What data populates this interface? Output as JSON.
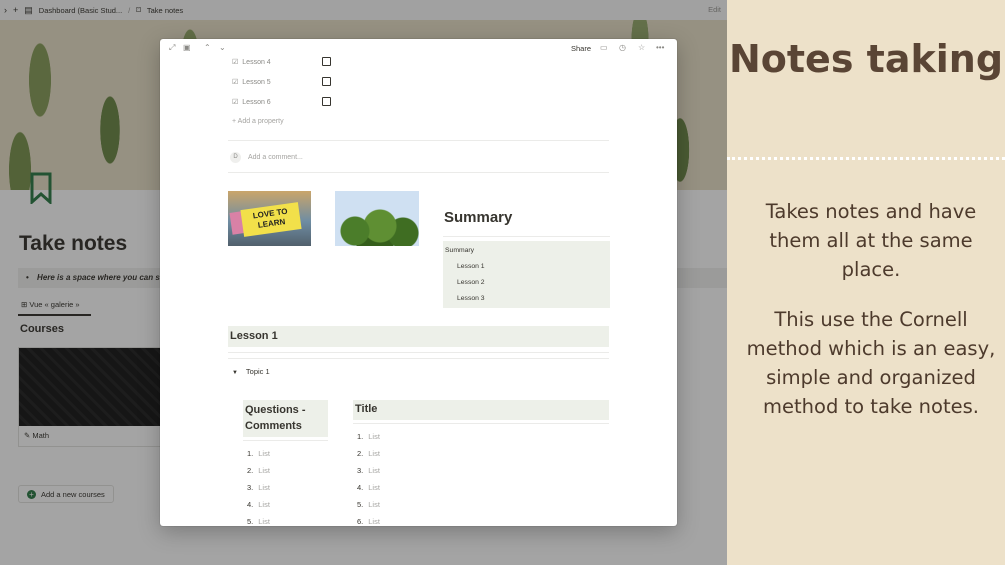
{
  "topbar": {
    "breadcrumb_1": "Dashboard (Basic Stud...",
    "separator": "/",
    "breadcrumb_2": "Take notes",
    "edit_label": "Edit"
  },
  "background_page": {
    "title": "Take notes",
    "callout": "Here is a space where you can s",
    "gallery_tab": "Vue « galerie »",
    "courses_heading": "Courses",
    "course_card_label": "Math",
    "add_course_label": "Add a new courses"
  },
  "modal": {
    "share_label": "Share",
    "properties": [
      {
        "label": "Lesson 4"
      },
      {
        "label": "Lesson 5"
      },
      {
        "label": "Lesson 6"
      }
    ],
    "add_property": "Add a property",
    "comment_avatar": "D",
    "comment_placeholder": "Add a comment...",
    "image_text": "LOVE TO LEARN",
    "summary_title": "Summary",
    "summary_box": {
      "heading": "Summary",
      "items": [
        "Lesson 1",
        "Lesson 2",
        "Lesson 3"
      ]
    },
    "lesson_heading": "Lesson 1",
    "topic": "Topic 1",
    "questions_heading": "Questions - Comments",
    "title_heading": "Title",
    "questions_list": [
      {
        "num": "1.",
        "text": "List"
      },
      {
        "num": "2.",
        "text": "List"
      },
      {
        "num": "3.",
        "text": "List"
      },
      {
        "num": "4.",
        "text": "List"
      },
      {
        "num": "5.",
        "text": "List"
      }
    ],
    "title_list": [
      {
        "num": "1.",
        "text": "List"
      },
      {
        "num": "2.",
        "text": "List"
      },
      {
        "num": "3.",
        "text": "List"
      },
      {
        "num": "4.",
        "text": "List"
      },
      {
        "num": "5.",
        "text": "List"
      },
      {
        "num": "6.",
        "text": "List"
      }
    ]
  },
  "panel": {
    "title": "Notes taking",
    "paragraph_1": "Takes notes and have them all at the same place.",
    "paragraph_2": "This use the Cornell method which is an easy, simple and organized method to take notes."
  },
  "colors": {
    "panel_bg": "#ede1c9",
    "panel_text": "#5a4535",
    "notion_accent_green": "#2f7d4a",
    "block_highlight": "#edf0e9"
  }
}
